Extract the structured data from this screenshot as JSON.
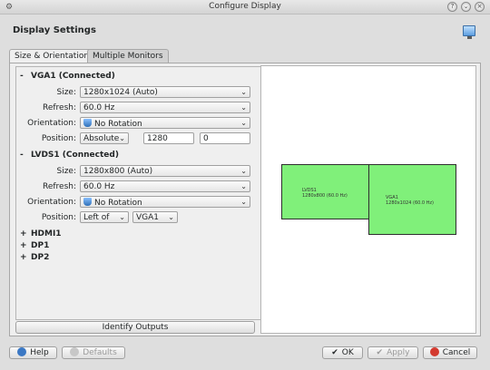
{
  "window": {
    "title": "Configure Display"
  },
  "header": {
    "title": "Display Settings"
  },
  "tabs": [
    {
      "label": "Size & Orientation"
    },
    {
      "label": "Multiple Monitors"
    }
  ],
  "outputs": {
    "vga1": {
      "header": "VGA1 (Connected)",
      "expander": "-",
      "size_label": "Size:",
      "size_value": "1280x1024 (Auto)",
      "refresh_label": "Refresh:",
      "refresh_value": "60.0 Hz",
      "orientation_label": "Orientation:",
      "orientation_value": "No Rotation",
      "position_label": "Position:",
      "position_mode": "Absolute",
      "position_x": "1280",
      "position_y": "0"
    },
    "lvds1": {
      "header": "LVDS1 (Connected)",
      "expander": "-",
      "size_label": "Size:",
      "size_value": "1280x800 (Auto)",
      "refresh_label": "Refresh:",
      "refresh_value": "60.0 Hz",
      "orientation_label": "Orientation:",
      "orientation_value": "No Rotation",
      "position_label": "Position:",
      "position_mode": "Left of",
      "position_target": "VGA1"
    },
    "collapsed": [
      {
        "expander": "+",
        "label": "HDMI1"
      },
      {
        "expander": "+",
        "label": "DP1"
      },
      {
        "expander": "+",
        "label": "DP2"
      }
    ]
  },
  "identify_button": "Identify Outputs",
  "preview": {
    "lvds1": {
      "name": "LVDS1",
      "mode": "1280x800 (60.0 Hz)"
    },
    "vga1": {
      "name": "VGA1",
      "mode": "1280x1024 (60.0 Hz)"
    },
    "monitor_color": "#80f07a"
  },
  "buttons": {
    "help": "Help",
    "defaults": "Defaults",
    "ok": "OK",
    "apply": "Apply",
    "cancel": "Cancel"
  }
}
